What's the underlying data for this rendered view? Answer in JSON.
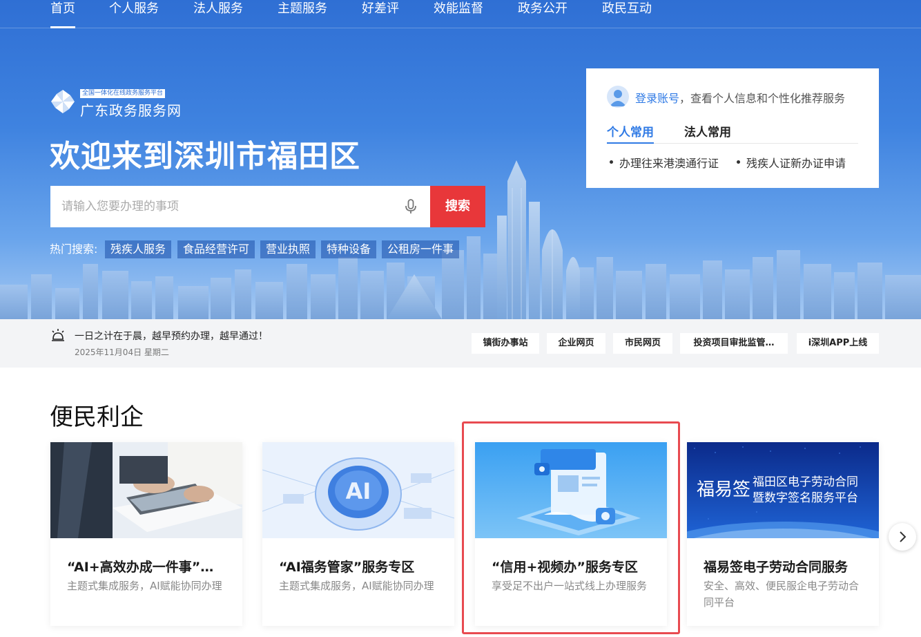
{
  "nav": {
    "items": [
      {
        "label": "首页",
        "active": true
      },
      {
        "label": "个人服务"
      },
      {
        "label": "法人服务"
      },
      {
        "label": "主题服务"
      },
      {
        "label": "好差评"
      },
      {
        "label": "效能监督"
      },
      {
        "label": "政务公开"
      },
      {
        "label": "政民互动"
      }
    ]
  },
  "logo": {
    "subtitle": "全国一体化在线政务服务平台",
    "title": "广东政务服务网"
  },
  "hero": {
    "welcome": "欢迎来到深圳市福田区"
  },
  "search": {
    "placeholder": "请输入您要办理的事项",
    "button": "搜索",
    "hot_label": "热门搜索:",
    "hot_tags": [
      "残疾人服务",
      "食品经营许可",
      "营业执照",
      "特种设备",
      "公租房一件事"
    ]
  },
  "login_card": {
    "login_link": "登录账号",
    "login_desc": "，查看个人信息和个性化推荐服务",
    "tabs": [
      "个人常用",
      "法人常用"
    ],
    "links": [
      "办理往来港澳通行证",
      "残疾人证新办证申请"
    ]
  },
  "infobar": {
    "notice": "一日之计在于晨，越早预约办理，越早通过！",
    "date": "2025年11月04日 星期二",
    "quick_links": [
      "镇街办事站",
      "企业网页",
      "市民网页",
      "投资项目审批监管…",
      "i深圳APP上线"
    ]
  },
  "section": {
    "title": "便民利企",
    "cards": [
      {
        "title": "“AI+高效办成一件事”…",
        "desc": "主题式集成服务，AI赋能协同办理"
      },
      {
        "title": "“AI福务管家”服务专区",
        "desc": "主题式集成服务，AI赋能协同办理"
      },
      {
        "title": "“信用+视频办”服务专区",
        "desc": "享受足不出户一站式线上办理服务"
      },
      {
        "title": "福易签电子劳动合同服务",
        "desc": "安全、高效、便民服企电子劳动合同平台"
      }
    ],
    "card4_banner": {
      "brand": "福易签",
      "line1": "福田区电子劳动合同",
      "line2": "暨数字签名服务平台"
    }
  },
  "icons": {
    "mic": "microphone-icon",
    "bell": "alarm-icon",
    "avatar": "user-avatar-icon",
    "next": "chevron-right-icon",
    "logo": "pinwheel-logo-icon"
  },
  "colors": {
    "primary_blue": "#2f7ae5",
    "search_red": "#e8373a",
    "highlight_red": "#e84a50"
  }
}
